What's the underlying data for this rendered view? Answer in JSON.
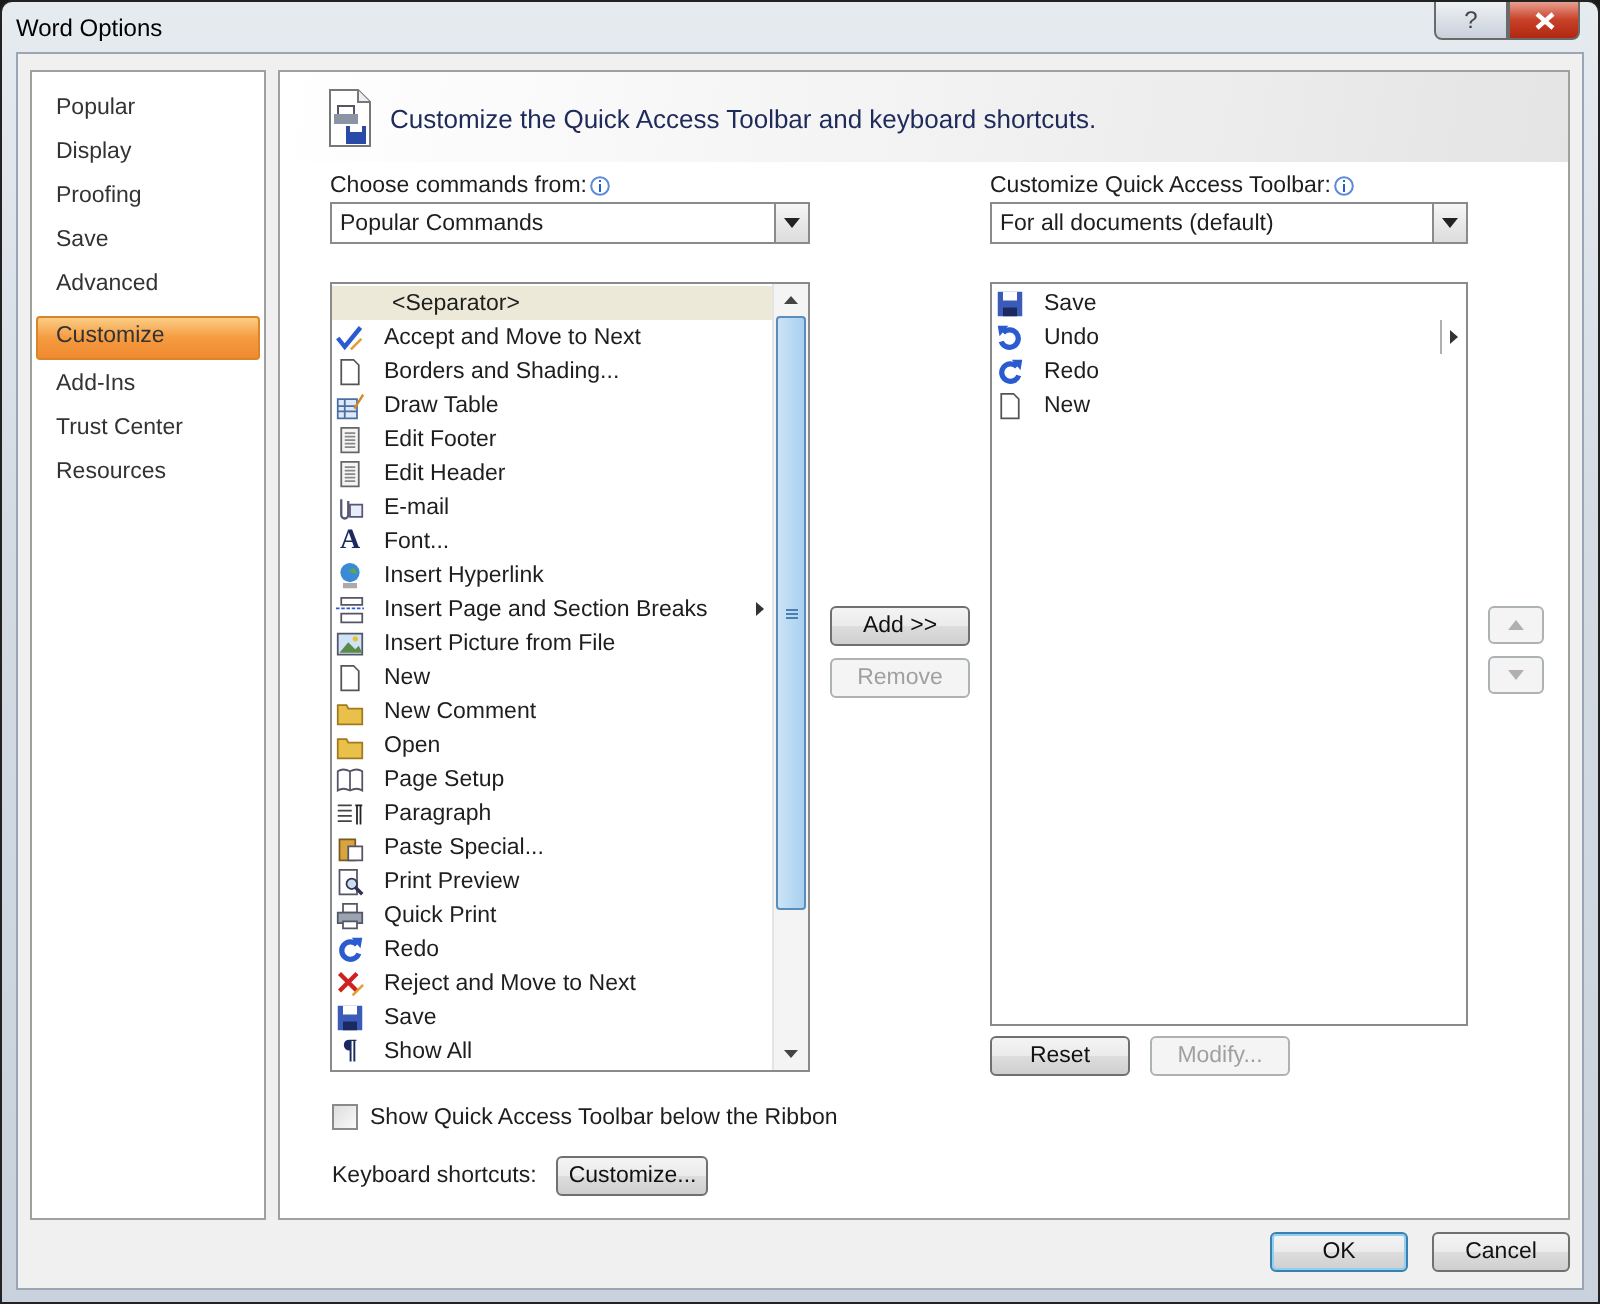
{
  "window": {
    "title": "Word Options",
    "help_button": "?"
  },
  "sidebar": {
    "items": [
      {
        "label": "Popular",
        "selected": false
      },
      {
        "label": "Display",
        "selected": false
      },
      {
        "label": "Proofing",
        "selected": false
      },
      {
        "label": "Save",
        "selected": false
      },
      {
        "label": "Advanced",
        "selected": false
      },
      {
        "label": "Customize",
        "selected": true
      },
      {
        "label": "Add-Ins",
        "selected": false
      },
      {
        "label": "Trust Center",
        "selected": false
      },
      {
        "label": "Resources",
        "selected": false
      }
    ]
  },
  "header": {
    "title": "Customize the Quick Access Toolbar and keyboard shortcuts."
  },
  "commands_from": {
    "label": "Choose commands from:",
    "value": "Popular Commands"
  },
  "toolbar_for": {
    "label": "Customize Quick Access Toolbar:",
    "value": "For all documents (default)"
  },
  "commands": [
    {
      "kind": "separator",
      "label": "<Separator>",
      "selected": true,
      "submenu": false
    },
    {
      "kind": "command",
      "label": "Accept and Move to Next",
      "selected": false,
      "submenu": false
    },
    {
      "kind": "command",
      "label": "Borders and Shading...",
      "selected": false,
      "submenu": false
    },
    {
      "kind": "command",
      "label": "Draw Table",
      "selected": false,
      "submenu": false
    },
    {
      "kind": "command",
      "label": "Edit Footer",
      "selected": false,
      "submenu": false
    },
    {
      "kind": "command",
      "label": "Edit Header",
      "selected": false,
      "submenu": false
    },
    {
      "kind": "command",
      "label": "E-mail",
      "selected": false,
      "submenu": false
    },
    {
      "kind": "command",
      "label": "Font...",
      "selected": false,
      "submenu": false,
      "icon_text": "A"
    },
    {
      "kind": "command",
      "label": "Insert Hyperlink",
      "selected": false,
      "submenu": false
    },
    {
      "kind": "command",
      "label": "Insert Page and Section Breaks",
      "selected": false,
      "submenu": true
    },
    {
      "kind": "command",
      "label": "Insert Picture from File",
      "selected": false,
      "submenu": false
    },
    {
      "kind": "command",
      "label": "New",
      "selected": false,
      "submenu": false
    },
    {
      "kind": "command",
      "label": "New Comment",
      "selected": false,
      "submenu": false
    },
    {
      "kind": "command",
      "label": "Open",
      "selected": false,
      "submenu": false
    },
    {
      "kind": "command",
      "label": "Page Setup",
      "selected": false,
      "submenu": false
    },
    {
      "kind": "command",
      "label": "Paragraph",
      "selected": false,
      "submenu": false
    },
    {
      "kind": "command",
      "label": "Paste Special...",
      "selected": false,
      "submenu": false
    },
    {
      "kind": "command",
      "label": "Print Preview",
      "selected": false,
      "submenu": false
    },
    {
      "kind": "command",
      "label": "Quick Print",
      "selected": false,
      "submenu": false
    },
    {
      "kind": "command",
      "label": "Redo",
      "selected": false,
      "submenu": false
    },
    {
      "kind": "command",
      "label": "Reject and Move to Next",
      "selected": false,
      "submenu": false
    },
    {
      "kind": "command",
      "label": "Save",
      "selected": false,
      "submenu": false
    },
    {
      "kind": "command",
      "label": "Show All",
      "selected": false,
      "submenu": false,
      "icon_text": "¶"
    }
  ],
  "toolbar_items": [
    {
      "label": "Save",
      "selected": false,
      "submenu": false
    },
    {
      "label": "Undo",
      "selected": false,
      "submenu": true
    },
    {
      "label": "Redo",
      "selected": false,
      "submenu": false
    },
    {
      "label": "New",
      "selected": false,
      "submenu": false
    }
  ],
  "add_button": {
    "label": "Add >>",
    "disabled": false
  },
  "remove_button": {
    "label": "Remove",
    "disabled": true
  },
  "move_up_button": {
    "disabled": true
  },
  "move_down_button": {
    "disabled": true
  },
  "reset_button": {
    "label": "Reset",
    "disabled": false
  },
  "modify_button": {
    "label": "Modify...",
    "disabled": true
  },
  "show_below_ribbon": {
    "label": "Show Quick Access Toolbar below the Ribbon",
    "checked": false
  },
  "keyboard_shortcuts": {
    "label": "Keyboard shortcuts:",
    "button": "Customize..."
  },
  "footer_buttons": [
    {
      "label": "OK",
      "default": true
    },
    {
      "label": "Cancel",
      "default": false
    }
  ]
}
